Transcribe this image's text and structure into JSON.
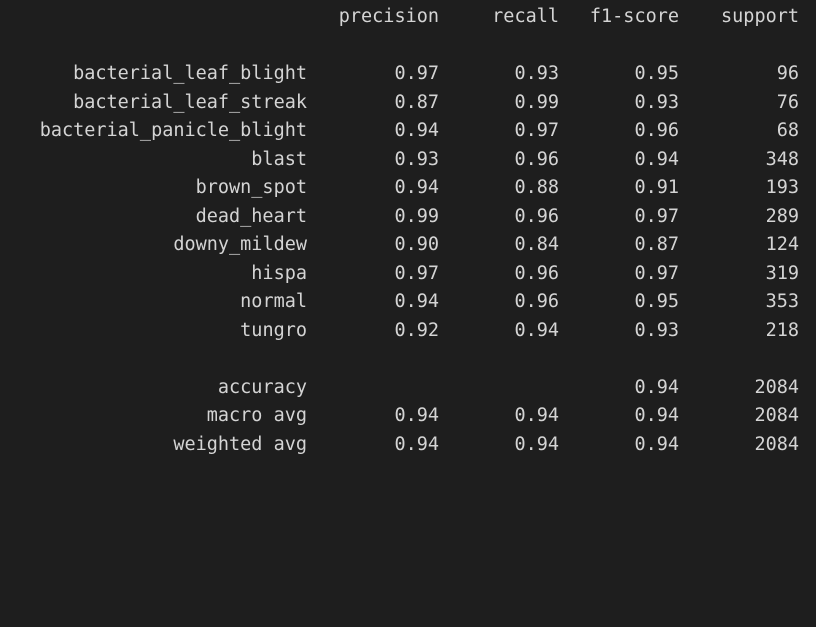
{
  "header": {
    "precision": "precision",
    "recall": "recall",
    "f1": "f1-score",
    "support": "support"
  },
  "classes": [
    {
      "label": "bacterial_leaf_blight",
      "precision": "0.97",
      "recall": "0.93",
      "f1": "0.95",
      "support": "96"
    },
    {
      "label": "bacterial_leaf_streak",
      "precision": "0.87",
      "recall": "0.99",
      "f1": "0.93",
      "support": "76"
    },
    {
      "label": "bacterial_panicle_blight",
      "precision": "0.94",
      "recall": "0.97",
      "f1": "0.96",
      "support": "68"
    },
    {
      "label": "blast",
      "precision": "0.93",
      "recall": "0.96",
      "f1": "0.94",
      "support": "348"
    },
    {
      "label": "brown_spot",
      "precision": "0.94",
      "recall": "0.88",
      "f1": "0.91",
      "support": "193"
    },
    {
      "label": "dead_heart",
      "precision": "0.99",
      "recall": "0.96",
      "f1": "0.97",
      "support": "289"
    },
    {
      "label": "downy_mildew",
      "precision": "0.90",
      "recall": "0.84",
      "f1": "0.87",
      "support": "124"
    },
    {
      "label": "hispa",
      "precision": "0.97",
      "recall": "0.96",
      "f1": "0.97",
      "support": "319"
    },
    {
      "label": "normal",
      "precision": "0.94",
      "recall": "0.96",
      "f1": "0.95",
      "support": "353"
    },
    {
      "label": "tungro",
      "precision": "0.92",
      "recall": "0.94",
      "f1": "0.93",
      "support": "218"
    }
  ],
  "summary": [
    {
      "label": "accuracy",
      "precision": "",
      "recall": "",
      "f1": "0.94",
      "support": "2084"
    },
    {
      "label": "macro avg",
      "precision": "0.94",
      "recall": "0.94",
      "f1": "0.94",
      "support": "2084"
    },
    {
      "label": "weighted avg",
      "precision": "0.94",
      "recall": "0.94",
      "f1": "0.94",
      "support": "2084"
    }
  ]
}
